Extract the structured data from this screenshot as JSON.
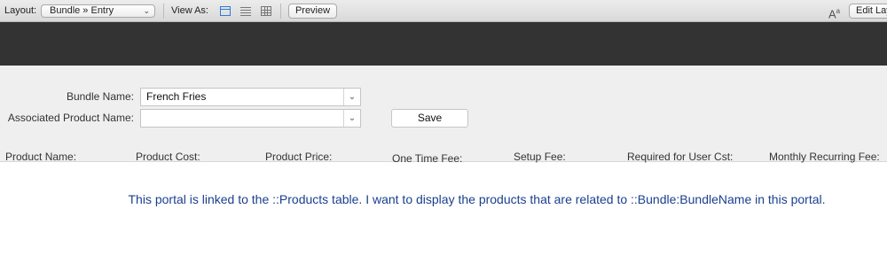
{
  "toolbar": {
    "layout_label": "Layout:",
    "layout_value": "Bundle » Entry",
    "view_as_label": "View As:",
    "preview_label": "Preview",
    "text_size_glyph": "A",
    "text_size_sup": "a",
    "edit_layout_label": "Edit Layout"
  },
  "form": {
    "bundle_name_label": "Bundle Name:",
    "bundle_name_value": "French Fries",
    "associated_product_label": "Associated Product Name:",
    "associated_product_value": "",
    "save_label": "Save"
  },
  "portal": {
    "columns": [
      "Product Name:",
      "Product Cost:",
      "Product Price:",
      "One Time Fee:",
      "Setup Fee:",
      "Required for User Cst:",
      "Monthly Recurring Fee:"
    ],
    "note": "This portal is linked to the ::Products table.  I want to display the products that are related to ::Bundle:BundleName in this portal."
  },
  "colors": {
    "header_band": "#333333",
    "note_text": "#1a3f8f",
    "view_selected": "#2f7bd9"
  },
  "icons": {
    "view_form": "form-view-icon",
    "view_list": "list-view-icon",
    "view_table": "table-view-icon",
    "dropdown": "chevron-down-icon",
    "text_size": "text-size-icon"
  }
}
